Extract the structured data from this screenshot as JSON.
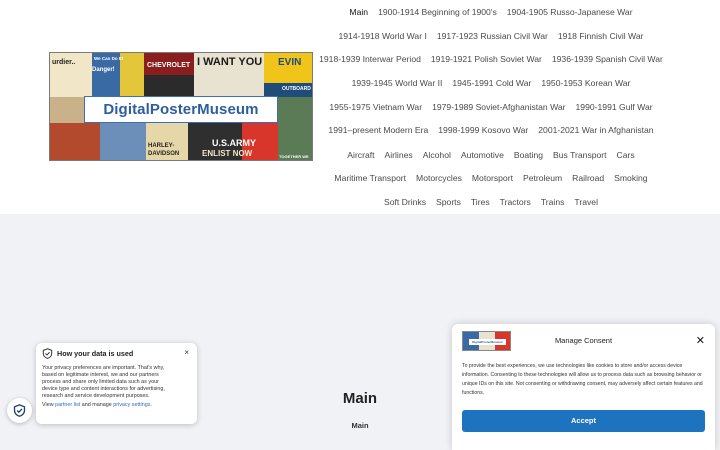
{
  "logo": {
    "title": "DigitalPosterMuseum",
    "poster_texts": {
      "surdier": "urdier..",
      "wecandoit": "We Can Do It!",
      "danger": "Danger!",
      "chevrolet": "CHEVROLET",
      "iwantyou": "I WANT YOU",
      "evin": "EVIN",
      "outboard": "OUTBOARD",
      "harley": "HARLEY-",
      "davidson": "DAVIDSON",
      "usarmy": "U.S.ARMY",
      "enlist": "ENLIST NOW",
      "together": "TOGETHER WE"
    }
  },
  "nav": {
    "rows": [
      [
        "Main",
        "1900-1914 Beginning of 1900's",
        "1904-1905 Russo-Japanese War"
      ],
      [
        "1914-1918 World War I",
        "1917-1923 Russian Civil War",
        "1918 Finnish Civil War"
      ],
      [
        "1918-1939 Interwar Period",
        "1919-1921 Polish Soviet War",
        "1936-1939 Spanish Civil War"
      ],
      [
        "1939-1945 World War II",
        "1945-1991 Cold War",
        "1950-1953 Korean War"
      ],
      [
        "1955-1975 Vietnam War",
        "1979-1989 Soviet-Afghanistan War",
        "1990-1991 Gulf War"
      ],
      [
        "1991–present Modern Era",
        "1998-1999 Kosovo War",
        "2001-2021 War in Afghanistan"
      ],
      [
        "Aircraft",
        "Airlines",
        "Alcohol",
        "Automotive",
        "Boating",
        "Bus Transport",
        "Cars"
      ],
      [
        "Maritime Transport",
        "Motorcycles",
        "Motorsport",
        "Petroleum",
        "Railroad",
        "Smoking"
      ],
      [
        "Soft Drinks",
        "Sports",
        "Tires",
        "Tractors",
        "Trains",
        "Travel"
      ]
    ],
    "active": "Main"
  },
  "main": {
    "heading": "Main",
    "breadcrumb": "Main"
  },
  "privacy_popup": {
    "title": "How your data is used",
    "body": "Your privacy preferences are important. That's why, based on legitimate interest, we and our partners process and share only limited data such as your device type and content interactions for advertising, research and service development purposes.",
    "footer_prefix": "View ",
    "partner_link": "partner list",
    "footer_mid": " and manage ",
    "settings_link": "privacy settings",
    "footer_suffix": ".",
    "close_label": "×"
  },
  "consent": {
    "title": "Manage Consent",
    "logo_text": "DigitalPosterMuseum",
    "text": "To provide the best experiences, we use technologies like cookies to store and/or access device information. Consenting to these technologies will allow us to process data such as browsing behavior or unique IDs on this site. Not consenting or withdrawing consent, may adversely affect certain features and functions.",
    "accept_label": "Accept",
    "close_label": "✕"
  },
  "colors": {
    "accent": "#1e73be",
    "link": "#2a6ac7",
    "logo_title": "#2d5e9e"
  }
}
